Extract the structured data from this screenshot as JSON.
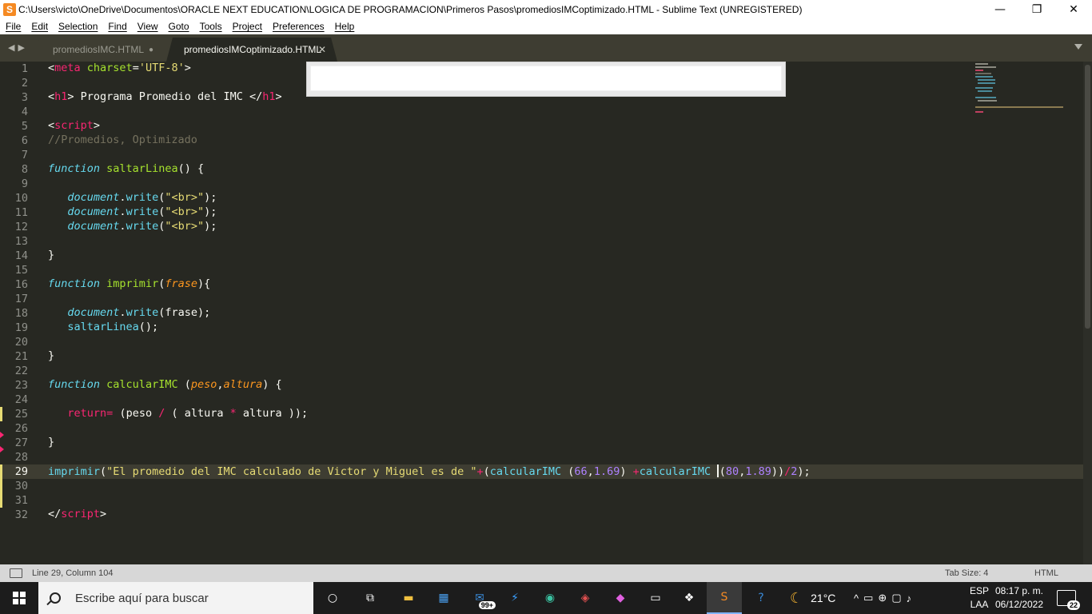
{
  "window": {
    "title": "C:\\Users\\victo\\OneDrive\\Documentos\\ORACLE NEXT EDUCATION\\LOGICA DE PROGRAMACION\\Primeros Pasos\\promediosIMCoptimizado.HTML - Sublime Text (UNREGISTERED)",
    "minimize": "—",
    "maximize": "❐",
    "close": "✕"
  },
  "menu": [
    "File",
    "Edit",
    "Selection",
    "Find",
    "View",
    "Goto",
    "Tools",
    "Project",
    "Preferences",
    "Help"
  ],
  "tabs": [
    {
      "label": "promediosIMC.HTML",
      "active": false,
      "dirty": true
    },
    {
      "label": "promediosIMCoptimizado.HTML",
      "active": true
    }
  ],
  "editor": {
    "current_line": 29,
    "lines": [
      {
        "n": "1"
      },
      {
        "n": "2"
      },
      {
        "n": "3"
      },
      {
        "n": "4"
      },
      {
        "n": "5"
      },
      {
        "n": "6"
      },
      {
        "n": "7"
      },
      {
        "n": "8"
      },
      {
        "n": "9"
      },
      {
        "n": "10"
      },
      {
        "n": "11"
      },
      {
        "n": "12"
      },
      {
        "n": "13"
      },
      {
        "n": "14"
      },
      {
        "n": "15"
      },
      {
        "n": "16"
      },
      {
        "n": "17"
      },
      {
        "n": "18"
      },
      {
        "n": "19"
      },
      {
        "n": "20"
      },
      {
        "n": "21"
      },
      {
        "n": "22"
      },
      {
        "n": "23"
      },
      {
        "n": "24"
      },
      {
        "n": "25"
      },
      {
        "n": "26"
      },
      {
        "n": "27"
      },
      {
        "n": "28"
      },
      {
        "n": "29"
      },
      {
        "n": "30"
      },
      {
        "n": "31"
      },
      {
        "n": "32"
      }
    ],
    "code": {
      "l1": [
        [
          "t-txt",
          "<"
        ],
        [
          "t-tag",
          "meta"
        ],
        [
          "t-txt",
          " "
        ],
        [
          "t-attr",
          "charset"
        ],
        [
          "t-txt",
          "="
        ],
        [
          "t-str",
          "'UTF-8'"
        ],
        [
          "t-txt",
          ">"
        ]
      ],
      "l3": [
        [
          "t-txt",
          "<"
        ],
        [
          "t-tag",
          "h1"
        ],
        [
          "t-txt",
          "> Programa Promedio del IMC </"
        ],
        [
          "t-tag",
          "h1"
        ],
        [
          "t-txt",
          ">"
        ]
      ],
      "l5": [
        [
          "t-txt",
          "<"
        ],
        [
          "t-tag",
          "script"
        ],
        [
          "t-txt",
          ">"
        ]
      ],
      "l6": [
        [
          "t-cmt",
          "//Promedios, Optimizado"
        ]
      ],
      "l8": [
        [
          "t-kw",
          "function"
        ],
        [
          "t-txt",
          " "
        ],
        [
          "t-fn",
          "saltarLinea"
        ],
        [
          "t-txt",
          "() {"
        ]
      ],
      "l10": [
        [
          "t-txt",
          "   "
        ],
        [
          "t-obj",
          "document"
        ],
        [
          "t-txt",
          "."
        ],
        [
          "t-call",
          "write"
        ],
        [
          "t-txt",
          "("
        ],
        [
          "t-str",
          "\"<br>\""
        ],
        [
          "t-txt",
          ");"
        ]
      ],
      "l11": [
        [
          "t-txt",
          "   "
        ],
        [
          "t-obj",
          "document"
        ],
        [
          "t-txt",
          "."
        ],
        [
          "t-call",
          "write"
        ],
        [
          "t-txt",
          "("
        ],
        [
          "t-str",
          "\"<br>\""
        ],
        [
          "t-txt",
          ");"
        ]
      ],
      "l12": [
        [
          "t-txt",
          "   "
        ],
        [
          "t-obj",
          "document"
        ],
        [
          "t-txt",
          "."
        ],
        [
          "t-call",
          "write"
        ],
        [
          "t-txt",
          "("
        ],
        [
          "t-str",
          "\"<br>\""
        ],
        [
          "t-txt",
          ");"
        ]
      ],
      "l14": [
        [
          "t-txt",
          "}"
        ]
      ],
      "l16": [
        [
          "t-kw",
          "function"
        ],
        [
          "t-txt",
          " "
        ],
        [
          "t-fn",
          "imprimir"
        ],
        [
          "t-txt",
          "("
        ],
        [
          "t-param",
          "frase"
        ],
        [
          "t-txt",
          "){"
        ]
      ],
      "l18": [
        [
          "t-txt",
          "   "
        ],
        [
          "t-obj",
          "document"
        ],
        [
          "t-txt",
          "."
        ],
        [
          "t-call",
          "write"
        ],
        [
          "t-txt",
          "(frase);"
        ]
      ],
      "l19": [
        [
          "t-txt",
          "   "
        ],
        [
          "t-call",
          "saltarLinea"
        ],
        [
          "t-txt",
          "();"
        ]
      ],
      "l21": [
        [
          "t-txt",
          "}"
        ]
      ],
      "l23": [
        [
          "t-kw",
          "function"
        ],
        [
          "t-txt",
          " "
        ],
        [
          "t-fn",
          "calcularIMC"
        ],
        [
          "t-txt",
          " ("
        ],
        [
          "t-param",
          "peso"
        ],
        [
          "t-txt",
          ","
        ],
        [
          "t-param",
          "altura"
        ],
        [
          "t-txt",
          ") {"
        ]
      ],
      "l25": [
        [
          "t-txt",
          "   "
        ],
        [
          "t-op",
          "return"
        ],
        [
          "t-op",
          "="
        ],
        [
          "t-txt",
          " (peso "
        ],
        [
          "t-op",
          "/"
        ],
        [
          "t-txt",
          " ( altura "
        ],
        [
          "t-op",
          "*"
        ],
        [
          "t-txt",
          " altura ));"
        ]
      ],
      "l27": [
        [
          "t-txt",
          "}"
        ]
      ],
      "l29a": [
        [
          "t-call",
          "imprimir"
        ],
        [
          "t-txt",
          "("
        ],
        [
          "t-str",
          "\"El promedio del IMC calculado de Victor y Miguel es de \""
        ],
        [
          "t-op",
          "+"
        ],
        [
          "t-txt",
          "("
        ],
        [
          "t-call",
          "calcularIMC"
        ],
        [
          "t-txt",
          " ("
        ],
        [
          "t-num",
          "66"
        ],
        [
          "t-txt",
          ","
        ],
        [
          "t-num",
          "1.69"
        ],
        [
          "t-txt",
          ") "
        ],
        [
          "t-op",
          "+"
        ],
        [
          "t-call",
          "calcularIMC"
        ],
        [
          "t-txt",
          " "
        ]
      ],
      "l29b": [
        [
          "t-txt",
          "("
        ],
        [
          "t-num",
          "80"
        ],
        [
          "t-txt",
          ","
        ],
        [
          "t-num",
          "1.89"
        ],
        [
          "t-txt",
          "))"
        ],
        [
          "t-op",
          "/"
        ],
        [
          "t-num",
          "2"
        ],
        [
          "t-txt",
          ");"
        ]
      ],
      "l32": [
        [
          "t-txt",
          "</"
        ],
        [
          "t-tag",
          "script"
        ],
        [
          "t-txt",
          ">"
        ]
      ]
    }
  },
  "status": {
    "position": "Line 29, Column 104",
    "tab_size": "Tab Size: 4",
    "syntax": "HTML"
  },
  "taskbar": {
    "search_placeholder": "Escribe aquí para buscar",
    "mail_badge": "99+",
    "weather": "21°C",
    "lang_top": "ESP",
    "lang_bottom": "LAA",
    "time": "08:17 p. m.",
    "date": "06/12/2022",
    "notifications": "22"
  }
}
